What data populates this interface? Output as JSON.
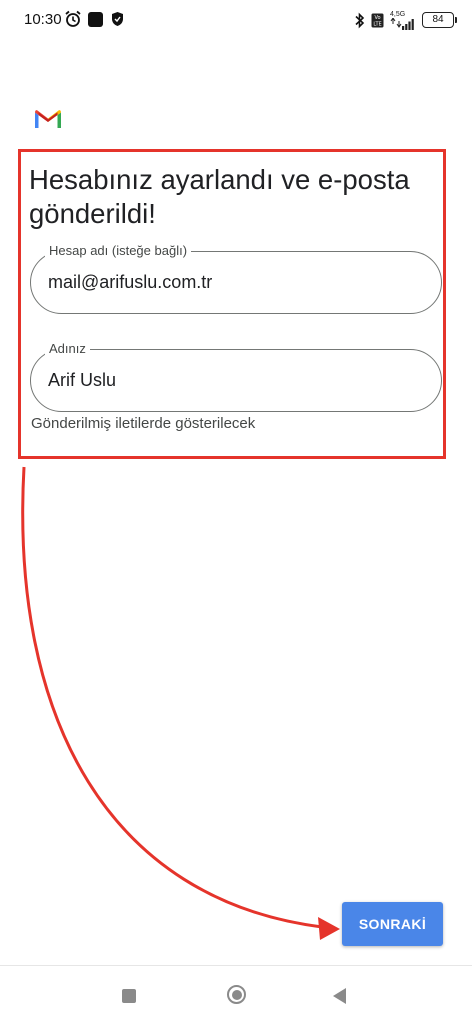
{
  "status_bar": {
    "time": "10:30",
    "network_label": "4,5G",
    "battery": "84",
    "icons": [
      "alarm-icon",
      "app-notification-icon",
      "shield-icon",
      "bluetooth-icon",
      "volte-icon",
      "signal-icon",
      "battery-icon"
    ]
  },
  "app": {
    "logo": "gmail-logo",
    "title": "Hesabınız ayarlandı ve e-posta gönderildi!"
  },
  "form": {
    "account_field": {
      "label": "Hesap adı (isteğe bağlı)",
      "value": "mail@arifuslu.com.tr"
    },
    "name_field": {
      "label": "Adınız",
      "value": "Arif Uslu",
      "helper": "Gönderilmiş iletilerde gösterilecek"
    }
  },
  "actions": {
    "next_label": "SONRAKİ"
  },
  "colors": {
    "annotation_red": "#e5342b",
    "button_blue": "#4a86e8",
    "text": "#202124",
    "outline": "#747775"
  },
  "nav_bar": {
    "icons": [
      "recents-icon",
      "home-icon",
      "back-icon"
    ]
  }
}
